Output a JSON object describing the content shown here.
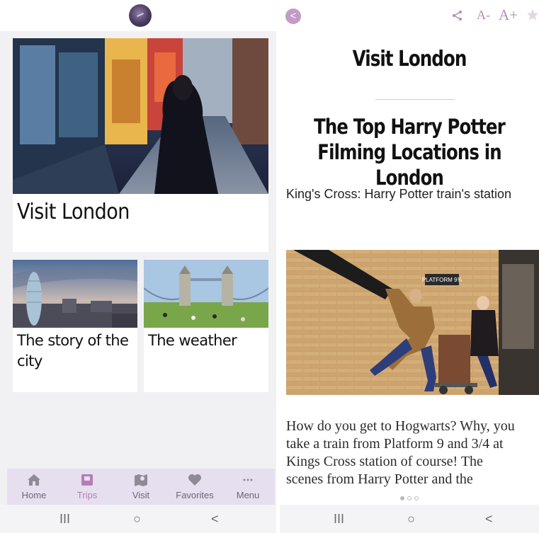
{
  "left_screen": {
    "featured_card": {
      "title": "Visit London"
    },
    "cards": [
      {
        "title": "The story of the city"
      },
      {
        "title": "The weather"
      }
    ],
    "bottom_nav": [
      {
        "label": "Home",
        "icon": "home-icon",
        "active": false
      },
      {
        "label": "Trips",
        "icon": "suitcase-icon",
        "active": true
      },
      {
        "label": "Visit",
        "icon": "map-icon",
        "active": false
      },
      {
        "label": "Favorites",
        "icon": "heart-icon",
        "active": false
      },
      {
        "label": "Menu",
        "icon": "more-icon",
        "active": false
      }
    ],
    "system_nav": {
      "recents": "III",
      "home": "○",
      "back": "<"
    }
  },
  "right_screen": {
    "toolbar": {
      "back": "<",
      "share": "share-icon",
      "text_smaller": "A-",
      "text_larger": "A+",
      "favorite": "star-icon"
    },
    "article": {
      "section_title": "Visit London",
      "headline": "The Top Harry Potter Filming Locations in London",
      "subtitle": "King's Cross: Harry Potter train's station",
      "body_lines": [
        "How do you get to Hogwarts? Why, you",
        "take a train from Platform 9 and 3/4 at",
        "Kings Cross station of course! The",
        "scenes from Harry Potter and the"
      ]
    },
    "image_sign": "PLATFORM 9¾",
    "pager": {
      "pages": 3,
      "current": 1
    },
    "system_nav": {
      "recents": "III",
      "home": "○",
      "back": "<"
    }
  },
  "colors": {
    "accent": "#b57fb3",
    "nav_bg": "#e6dff0",
    "page_bg": "#f1f1f3",
    "back_button": "#c39ac8"
  }
}
